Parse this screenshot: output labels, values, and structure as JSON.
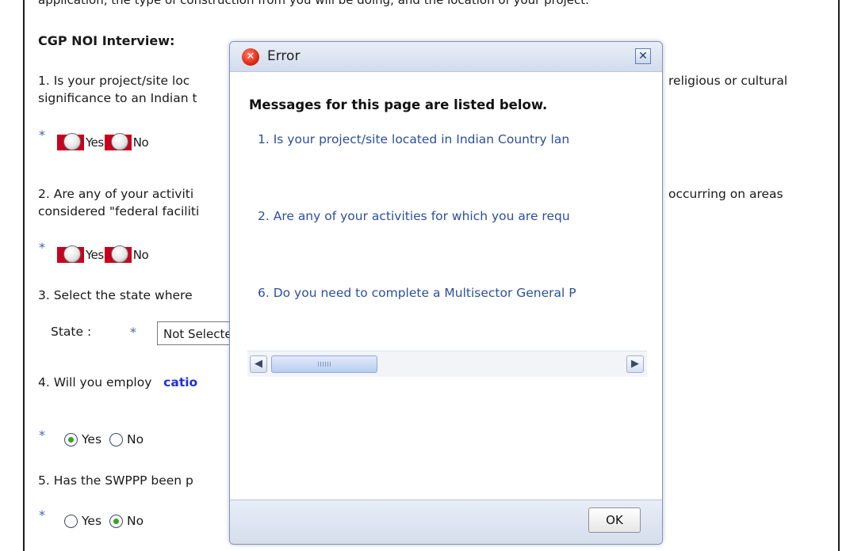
{
  "page": {
    "cut_top_text": "application, the type of construction from you will be doing, and the location of your project.",
    "heading": "CGP NOI Interview:",
    "q1": {
      "left_line1": "1. Is your project/site loc",
      "right_line1": "religious or cultural",
      "left_line2": "significance to an Indian t",
      "yes": "Yes",
      "no": "No"
    },
    "q2": {
      "left_line1": "2. Are any of your activiti",
      "right_line1": "occurring on areas",
      "left_line2": "considered \"federal faciliti",
      "yes": "Yes",
      "no": "No"
    },
    "q3": {
      "text": "3. Select the state where",
      "state_label": "State :",
      "state_value": "Not Selected"
    },
    "q4": {
      "text": "4. Will you employ",
      "link": "catio",
      "yes": "Yes",
      "no": "No",
      "selected": "Yes"
    },
    "q5": {
      "text": "5. Has the SWPPP been p",
      "yes": "Yes",
      "no": "No",
      "selected": "No"
    },
    "required_marker": "*"
  },
  "dialog": {
    "title": "Error",
    "icon": "error-x-icon",
    "close_glyph": "✕",
    "heading": "Messages for this page are listed below.",
    "messages": [
      "1. Is your project/site located in Indian Country lan",
      "2. Are any of your activities for which you are requ",
      "6. Do you need to complete a Multisector General P"
    ],
    "ok_label": "OK"
  },
  "colors": {
    "error_highlight": "#c8001e",
    "link_blue": "#2b4f9c",
    "radio_checked": "#35a51f",
    "asterisk": "#3a66b3"
  }
}
